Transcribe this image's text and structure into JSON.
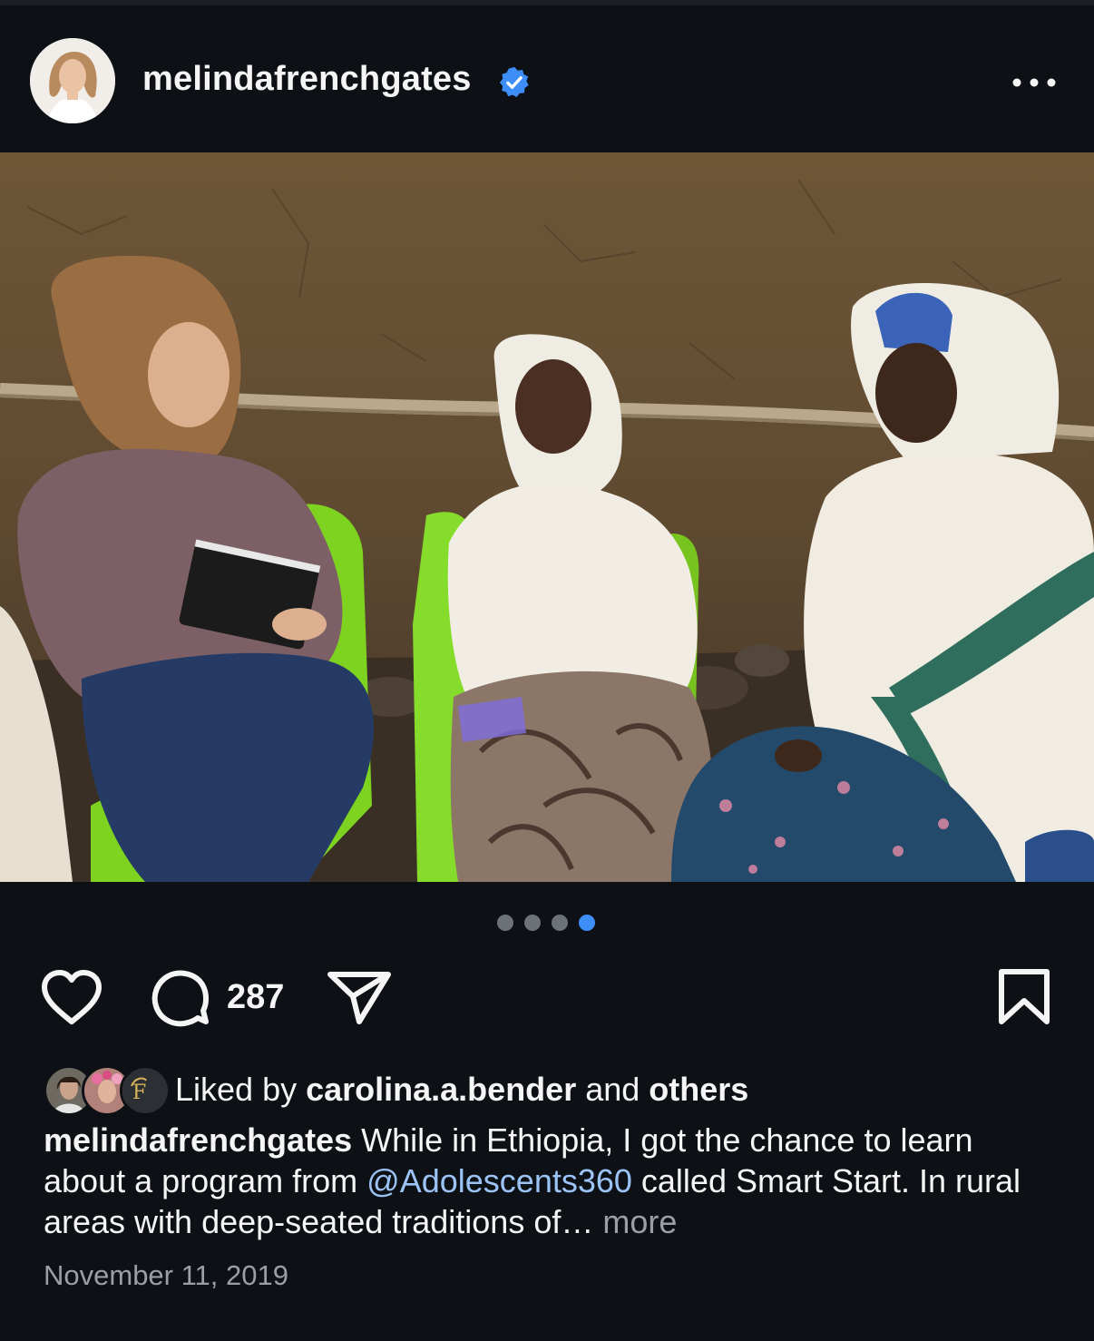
{
  "post": {
    "username": "melindafrenchgates",
    "verified": true,
    "more_icon": "more-horizontal-icon"
  },
  "carousel": {
    "total": 4,
    "active_index": 4
  },
  "actions": {
    "like_icon": "heart-icon",
    "comment_icon": "comment-icon",
    "comment_count": "287",
    "share_icon": "paper-plane-icon",
    "save_icon": "bookmark-icon"
  },
  "likes": {
    "prefix": "Liked by ",
    "user": "carolina.a.bender",
    "middle": " and ",
    "others": "others"
  },
  "caption": {
    "username": "melindafrenchgates",
    "text_part1": " While in Ethiopia, I got the chance to learn about a program from ",
    "mention": "@Adolescents360",
    "text_part2": " called Smart Start. In rural areas with deep-seated traditions of… ",
    "more_label": "more"
  },
  "date": "November 11, 2019",
  "colors": {
    "background": "#0d1015",
    "accent_blue": "#3e8ef7",
    "mention_blue": "#9cc3f5",
    "muted": "#9a9ea6"
  }
}
